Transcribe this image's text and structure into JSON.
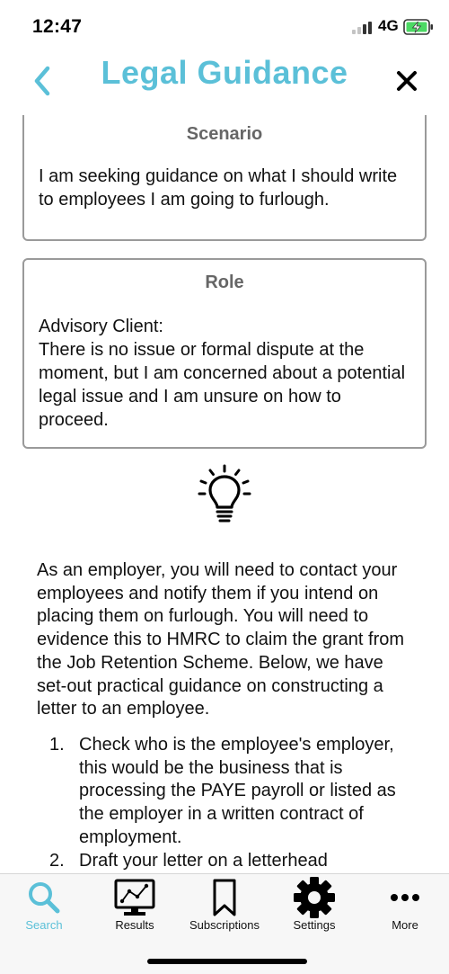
{
  "status_bar": {
    "time": "12:47",
    "network": "4G"
  },
  "header": {
    "title": "Legal Guidance",
    "back_icon": "chevron-left-icon",
    "close_icon": "close-icon"
  },
  "scenario": {
    "title": "Scenario",
    "text": "I am seeking guidance on what I should write to employees I am going to furlough."
  },
  "role": {
    "title": "Role",
    "line1": "Advisory Client:",
    "line2": "There is no issue or formal dispute at the moment, but I am concerned about a potential legal issue and I am unsure on how to proceed."
  },
  "guidance": {
    "icon": "lightbulb-icon",
    "intro": "As an employer, you will need to contact your employees and notify them if you intend on placing them on furlough. You will need to evidence this to HMRC to claim the grant from the Job Retention Scheme. Below, we have set-out practical guidance on constructing a letter to an employee.",
    "steps": [
      {
        "number": "1.",
        "text": "Check who is the employee's employer, this would be the business that is processing the PAYE payroll or listed as the employer in a written contract of employment."
      },
      {
        "number": "2.",
        "text": "Draft your letter on a letterhead"
      }
    ]
  },
  "tab_bar": {
    "active_color": "#5bc0d8",
    "tabs": [
      {
        "label": "Search",
        "icon": "search-icon",
        "active": true
      },
      {
        "label": "Results",
        "icon": "results-chart-icon",
        "active": false
      },
      {
        "label": "Subscriptions",
        "icon": "bookmark-icon",
        "active": false
      },
      {
        "label": "Settings",
        "icon": "gear-icon",
        "active": false
      },
      {
        "label": "More",
        "icon": "more-dots-icon",
        "active": false
      }
    ]
  },
  "colors": {
    "accent": "#5bc0d8",
    "card_border": "#9a9a9a",
    "card_title": "#666666"
  }
}
